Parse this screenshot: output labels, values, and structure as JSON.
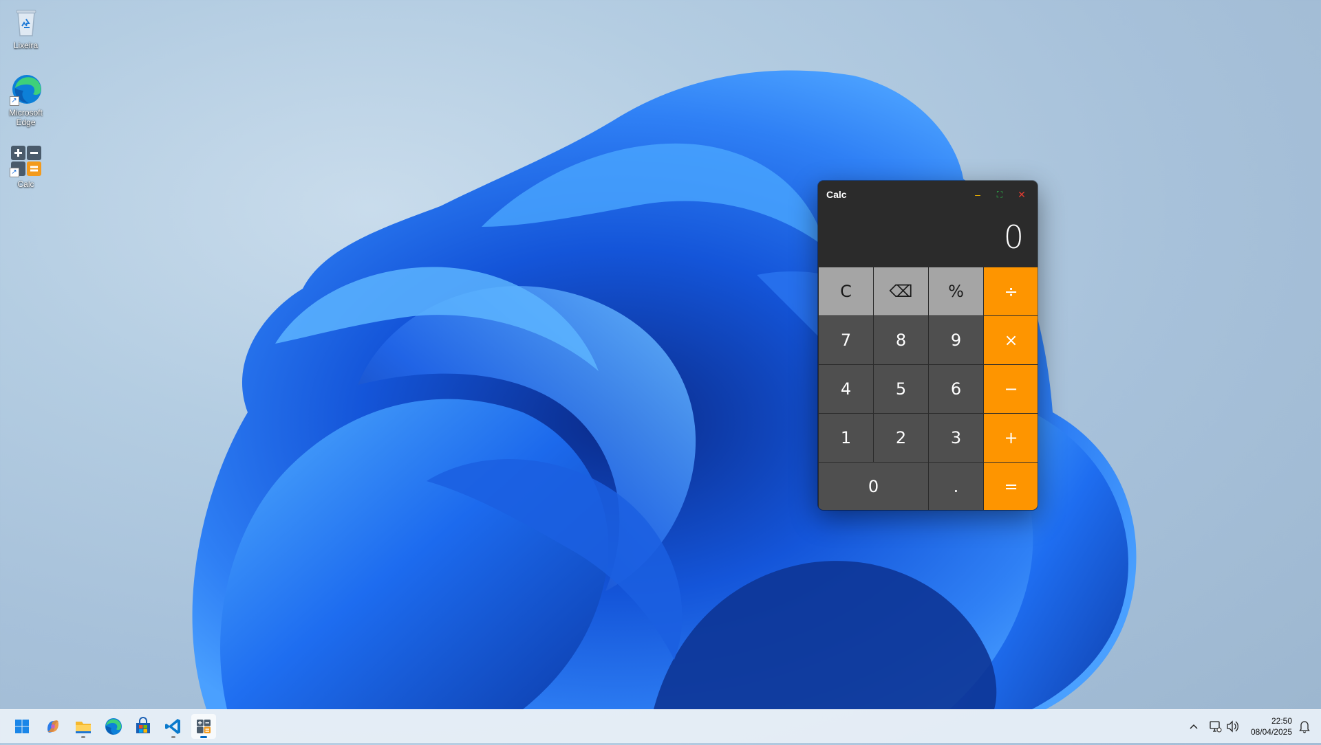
{
  "desktop": {
    "icons": [
      {
        "label": "Lixeira",
        "icon": "recycle-bin-icon"
      },
      {
        "label": "Microsoft Edge",
        "icon": "edge-icon"
      },
      {
        "label": "Calc",
        "icon": "calculator-icon"
      }
    ]
  },
  "calculator": {
    "title": "Calc",
    "display_value": "0",
    "controls": {
      "minimize": "–",
      "maximize": "⛶",
      "close": "✕"
    },
    "control_colors": {
      "minimize": "#f0b400",
      "maximize": "#2db34a",
      "close": "#e03c31"
    },
    "keys": {
      "clear": "C",
      "backspace": "⌫",
      "percent": "%",
      "divide": "÷",
      "seven": "7",
      "eight": "8",
      "nine": "9",
      "multiply": "×",
      "four": "4",
      "five": "5",
      "six": "6",
      "minus": "−",
      "one": "1",
      "two": "2",
      "three": "3",
      "plus": "+",
      "zero": "0",
      "decimal": ".",
      "equals": "="
    },
    "colors": {
      "function": "#a5a5a5",
      "number": "#4f4f4f",
      "operator": "#fe9500",
      "background": "#2b2b2b"
    }
  },
  "taskbar": {
    "apps": [
      {
        "name": "start-button",
        "icon": "windows-logo-icon"
      },
      {
        "name": "copilot",
        "icon": "copilot-icon"
      },
      {
        "name": "file-explorer",
        "icon": "folder-icon"
      },
      {
        "name": "edge",
        "icon": "edge-icon"
      },
      {
        "name": "store",
        "icon": "store-icon"
      },
      {
        "name": "vscode",
        "icon": "vscode-icon"
      },
      {
        "name": "calc",
        "icon": "calculator-icon"
      }
    ],
    "tray": {
      "overflow": "^",
      "time": "22:50",
      "date": "08/04/2025"
    }
  }
}
